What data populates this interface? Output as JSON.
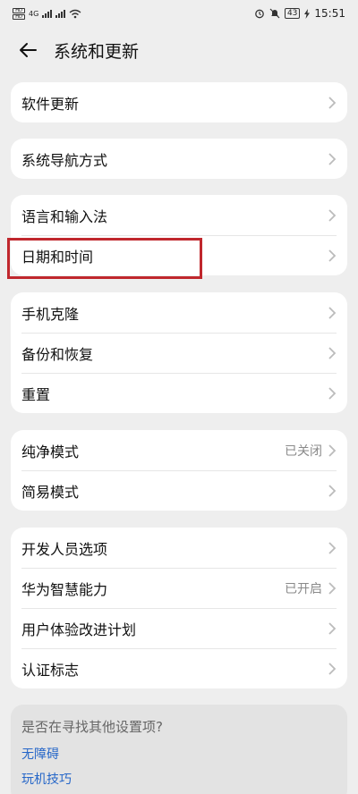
{
  "statusbar": {
    "time": "15:51",
    "battery": "43",
    "network": "4G"
  },
  "header": {
    "title": "系统和更新"
  },
  "groups": [
    {
      "items": [
        {
          "label": "软件更新"
        }
      ]
    },
    {
      "items": [
        {
          "label": "系统导航方式"
        }
      ]
    },
    {
      "items": [
        {
          "label": "语言和输入法"
        },
        {
          "label": "日期和时间"
        }
      ]
    },
    {
      "items": [
        {
          "label": "手机克隆"
        },
        {
          "label": "备份和恢复"
        },
        {
          "label": "重置"
        }
      ]
    },
    {
      "items": [
        {
          "label": "纯净模式",
          "status": "已关闭"
        },
        {
          "label": "简易模式"
        }
      ]
    },
    {
      "items": [
        {
          "label": "开发人员选项"
        },
        {
          "label": "华为智慧能力",
          "status": "已开启"
        },
        {
          "label": "用户体验改进计划"
        },
        {
          "label": "认证标志"
        }
      ]
    }
  ],
  "footer": {
    "title": "是否在寻找其他设置项?",
    "links": [
      "无障碍",
      "玩机技巧"
    ]
  },
  "colors": {
    "background": "#eeeeee",
    "card": "#ffffff",
    "highlight": "#c0272d",
    "link": "#2566c8"
  }
}
